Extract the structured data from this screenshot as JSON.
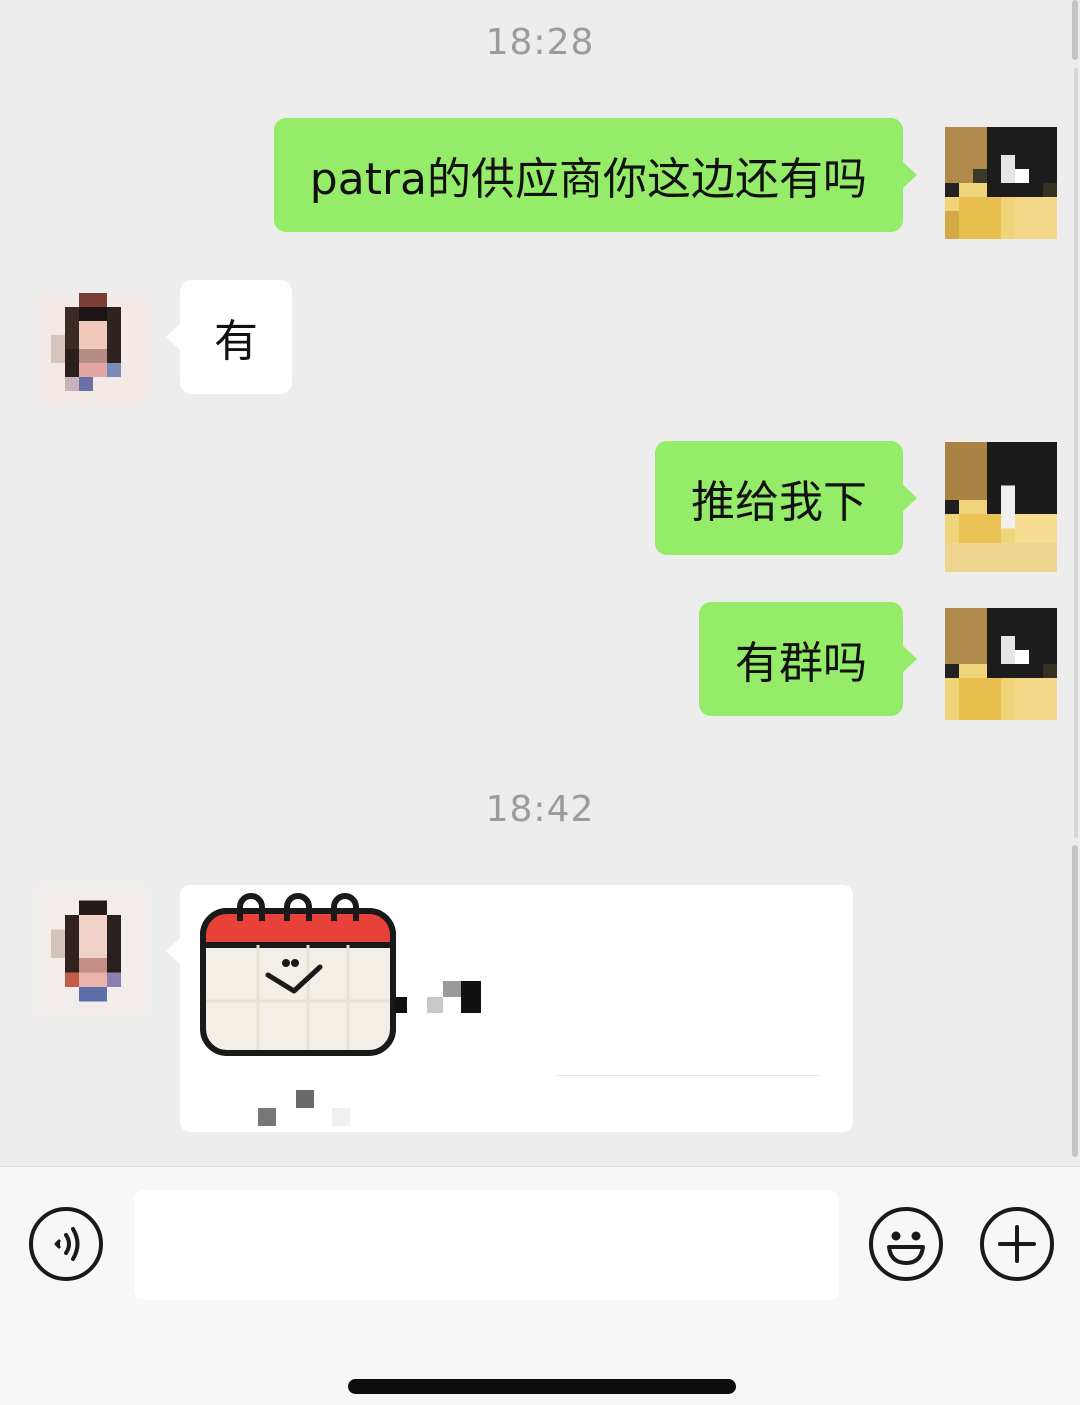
{
  "chat": {
    "timestamps": [
      "18:28",
      "18:42"
    ],
    "messages": [
      {
        "sender": "me",
        "text": "patra的供应商你这边还有吗"
      },
      {
        "sender": "them",
        "text": "有"
      },
      {
        "sender": "me",
        "text": "推给我下"
      },
      {
        "sender": "me",
        "text": "有群吗"
      },
      {
        "sender": "them",
        "type": "card",
        "icon": "calendar-sticker-icon"
      }
    ]
  },
  "input_bar": {
    "voice_icon": "voice-icon",
    "emoji_icon": "emoji-icon",
    "more_icon": "plus-icon",
    "text_value": ""
  },
  "colors": {
    "background": "#ededed",
    "outgoing_bubble": "#95ec69",
    "incoming_bubble": "#ffffff",
    "timestamp_text": "#9b9b9b",
    "calendar_red": "#e8413a"
  }
}
